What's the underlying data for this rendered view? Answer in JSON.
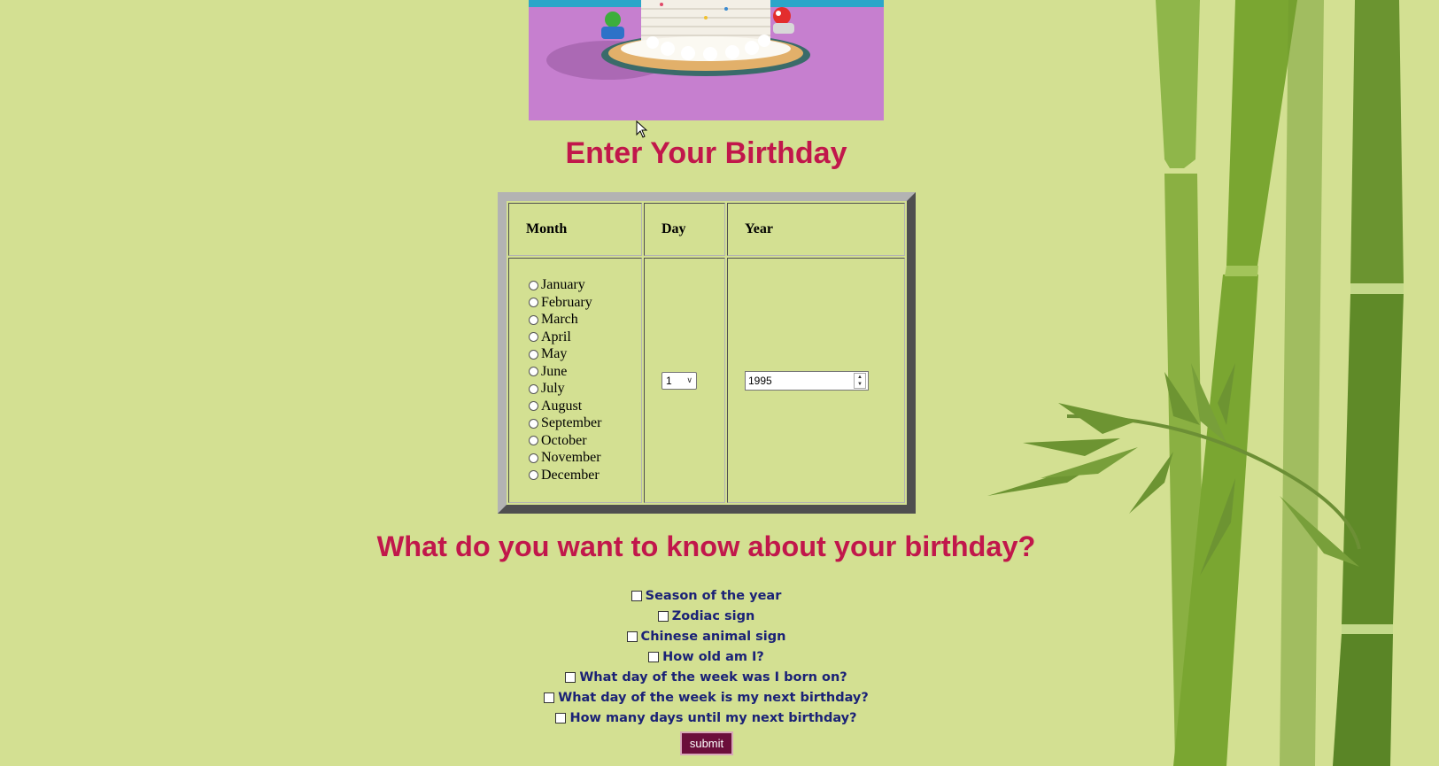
{
  "headings": {
    "enter_birthday": "Enter Your Birthday",
    "what_to_know": "What do you want to know about your birthday?"
  },
  "table": {
    "col_month": "Month",
    "col_day": "Day",
    "col_year": "Year"
  },
  "months": [
    "January",
    "February",
    "March",
    "April",
    "May",
    "June",
    "July",
    "August",
    "September",
    "October",
    "November",
    "December"
  ],
  "day_select": {
    "value": "1"
  },
  "year_input": {
    "value": "1995"
  },
  "options": [
    "Season of the year",
    "Zodiac sign",
    "Chinese animal sign",
    "How old am I?",
    "What day of the week was I born on?",
    "What day of the week is my next birthday?",
    "How many days until my next birthday?"
  ],
  "submit_label": "submit",
  "colors": {
    "background": "#d3e092",
    "heading": "#c1174b",
    "option_text": "#1b2276",
    "submit_bg": "#6b0e3b"
  }
}
